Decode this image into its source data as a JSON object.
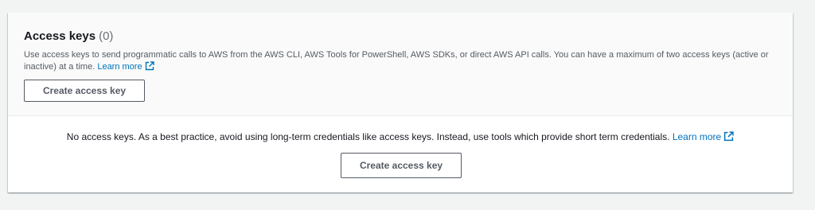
{
  "access_keys": {
    "title": "Access keys",
    "count": "(0)",
    "description": "Use access keys to send programmatic calls to AWS from the AWS CLI, AWS Tools for PowerShell, AWS SDKs, or direct AWS API calls. You can have a maximum of two access keys (active or inactive) at a time.",
    "learn_more_label": "Learn more",
    "create_button_label": "Create access key"
  },
  "empty_state": {
    "message": "No access keys. As a best practice, avoid using long-term credentials like access keys. Instead, use tools which provide short term credentials.",
    "learn_more_label": "Learn more",
    "create_button_label": "Create access key"
  },
  "icons": {
    "external_link": "external-link-icon"
  },
  "colors": {
    "link": "#0073bb",
    "page_background": "#f2f3f3",
    "header_background": "#fafafa",
    "button_border": "#545b64"
  }
}
